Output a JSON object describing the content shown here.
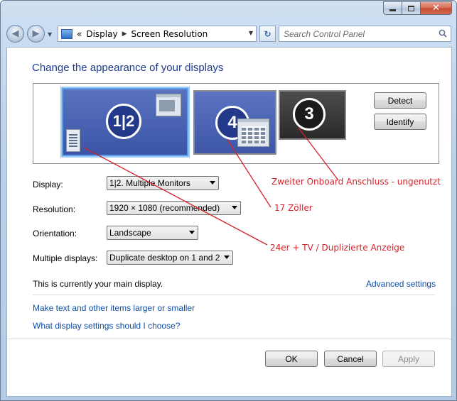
{
  "window": {
    "caption": {
      "minimize_icon": "minimize-icon",
      "maximize_icon": "maximize-icon",
      "close_icon": "close-icon",
      "close_glyph": "✕"
    }
  },
  "navbar": {
    "back_glyph": "◀",
    "forward_glyph": "▶",
    "history_glyph": "▼",
    "address": {
      "overflow": "«",
      "items": [
        "Display",
        "Screen Resolution"
      ],
      "separator": "▶",
      "drop": "▼"
    },
    "refresh_glyph": "↻",
    "search_placeholder": "Search Control Panel"
  },
  "page": {
    "heading": "Change the appearance of your displays",
    "monitors": [
      {
        "label": "1|2"
      },
      {
        "label": "4"
      },
      {
        "label": "3"
      }
    ],
    "detect_label": "Detect",
    "identify_label": "Identify",
    "settings": {
      "display": {
        "label": "Display:",
        "value": "1|2. Multiple Monitors"
      },
      "resolution": {
        "label": "Resolution:",
        "value": "1920 × 1080 (recommended)"
      },
      "orientation": {
        "label": "Orientation:",
        "value": "Landscape"
      },
      "multiple": {
        "label": "Multiple displays:",
        "value": "Duplicate desktop on 1 and 2"
      }
    },
    "main_display_text": "This is currently your main display.",
    "advanced_link": "Advanced settings",
    "links": [
      "Make text and other items larger or smaller",
      "What display settings should I choose?"
    ],
    "ok_label": "OK",
    "cancel_label": "Cancel",
    "apply_label": "Apply"
  },
  "annotations": {
    "color": "#d5202a",
    "items": [
      "Zweiter Onboard Anschluss - ungenutzt",
      "17 Zöller",
      "24er + TV / Duplizierte Anzeige"
    ]
  },
  "colors": {
    "heading": "#1e3b8c",
    "link": "#0f4fa8",
    "selected_monitor_border": "#5aa0e8"
  }
}
